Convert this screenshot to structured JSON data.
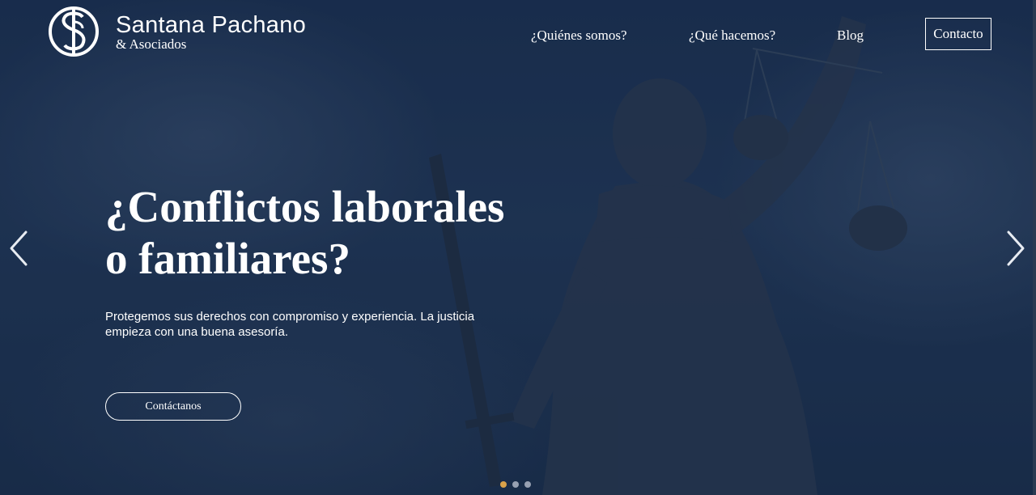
{
  "brand": {
    "name": "Santana Pachano",
    "subtitle": "& Asociados",
    "logo_icon": "sp-monogram-icon"
  },
  "nav": {
    "items": [
      {
        "label": "¿Quiénes somos?"
      },
      {
        "label": "¿Qué hacemos?"
      },
      {
        "label": "Blog"
      }
    ],
    "contact_label": "Contacto"
  },
  "hero": {
    "headline_line1": "¿Conflictos laborales",
    "headline_line2": "o familiares?",
    "subtitle": "Protegemos sus derechos con compromiso y experiencia. La justicia empieza con una buena asesoría.",
    "cta_label": "Contáctanos",
    "background_image": "lady-justice-statue"
  },
  "carousel": {
    "prev_icon": "chevron-left-icon",
    "next_icon": "chevron-right-icon",
    "slides": 3,
    "active_slide": 1
  },
  "colors": {
    "accent": "#d9a24a",
    "overlay": "#1d3150",
    "text": "#ffffff"
  }
}
